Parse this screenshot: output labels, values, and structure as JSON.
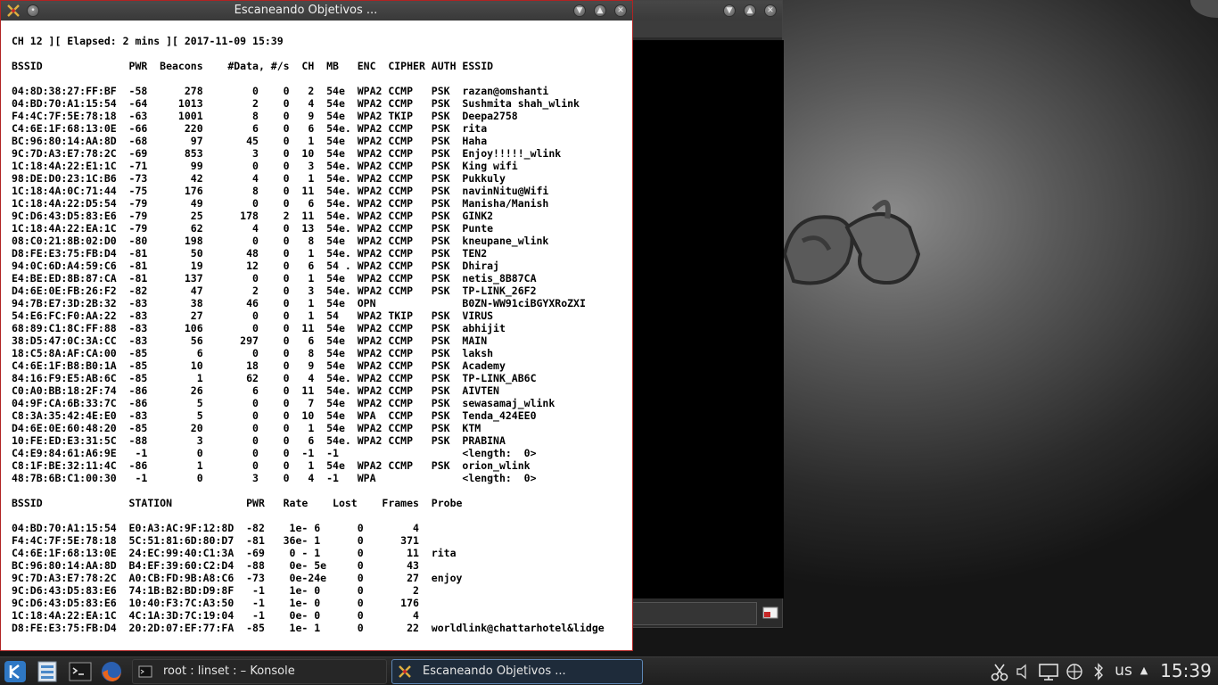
{
  "main_window": {
    "title": "Escaneando Objetivos ...",
    "terminal_lines": [
      "CH 12 ][ Elapsed: 2 mins ][ 2017-11-09 15:39",
      "",
      "BSSID              PWR  Beacons    #Data, #/s  CH  MB   ENC  CIPHER AUTH ESSID",
      "",
      "04:8D:38:27:FF:BF  -58      278        0    0   2  54e  WPA2 CCMP   PSK  razan@omshanti",
      "04:BD:70:A1:15:54  -64     1013        2    0   4  54e  WPA2 CCMP   PSK  Sushmita shah_wlink",
      "F4:4C:7F:5E:78:18  -63     1001        8    0   9  54e  WPA2 TKIP   PSK  Deepa2758",
      "C4:6E:1F:68:13:0E  -66      220        6    0   6  54e. WPA2 CCMP   PSK  rita",
      "BC:96:80:14:AA:8D  -68       97       45    0   1  54e  WPA2 CCMP   PSK  Haha",
      "9C:7D:A3:E7:78:2C  -69      853        3    0  10  54e  WPA2 CCMP   PSK  Enjoy!!!!!_wlink",
      "1C:18:4A:22:E1:1C  -71       99        0    0   3  54e. WPA2 CCMP   PSK  King wifi",
      "98:DE:D0:23:1C:B6  -73       42        4    0   1  54e. WPA2 CCMP   PSK  Pukkuly",
      "1C:18:4A:0C:71:44  -75      176        8    0  11  54e. WPA2 CCMP   PSK  navinNitu@Wifi",
      "1C:18:4A:22:D5:54  -79       49        0    0   6  54e. WPA2 CCMP   PSK  Manisha/Manish",
      "9C:D6:43:D5:83:E6  -79       25      178    2  11  54e. WPA2 CCMP   PSK  GINK2",
      "1C:18:4A:22:EA:1C  -79       62        4    0  13  54e. WPA2 CCMP   PSK  Punte",
      "08:C0:21:8B:02:D0  -80      198        0    0   8  54e  WPA2 CCMP   PSK  kneupane_wlink",
      "D8:FE:E3:75:FB:D4  -81       50       48    0   1  54e. WPA2 CCMP   PSK  TEN2",
      "94:0C:6D:A4:59:C6  -81       19       12    0   6  54 . WPA2 CCMP   PSK  Dhiraj",
      "E4:BE:ED:8B:87:CA  -81      137        0    0   1  54e  WPA2 CCMP   PSK  netis_8B87CA",
      "D4:6E:0E:FB:26:F2  -82       47        2    0   3  54e. WPA2 CCMP   PSK  TP-LINK_26F2",
      "94:7B:E7:3D:2B:32  -83       38       46    0   1  54e  OPN              B0ZN-WW91ciBGYXRoZXI",
      "54:E6:FC:F0:AA:22  -83       27        0    0   1  54   WPA2 TKIP   PSK  VIRUS",
      "68:89:C1:8C:FF:88  -83      106        0    0  11  54e  WPA2 CCMP   PSK  abhijit",
      "38:D5:47:0C:3A:CC  -83       56      297    0   6  54e  WPA2 CCMP   PSK  MAIN",
      "18:C5:8A:AF:CA:00  -85        6        0    0   8  54e  WPA2 CCMP   PSK  laksh",
      "C4:6E:1F:B8:B0:1A  -85       10       18    0   9  54e  WPA2 CCMP   PSK  Academy",
      "84:16:F9:E5:AB:6C  -85        1       62    0   4  54e. WPA2 CCMP   PSK  TP-LINK_AB6C",
      "C0:A0:BB:18:2F:74  -86       26        6    0  11  54e. WPA2 CCMP   PSK  AIVTEN",
      "04:9F:CA:6B:33:7C  -86        5        0    0   7  54e  WPA2 CCMP   PSK  sewasamaj_wlink",
      "C8:3A:35:42:4E:E0  -83        5        0    0  10  54e  WPA  CCMP   PSK  Tenda_424EE0",
      "D4:6E:0E:60:48:20  -85       20        0    0   1  54e  WPA2 CCMP   PSK  KTM",
      "10:FE:ED:E3:31:5C  -88        3        0    0   6  54e. WPA2 CCMP   PSK  PRABINA",
      "C4:E9:84:61:A6:9E   -1        0        0    0  -1  -1                    <length:  0>",
      "C8:1F:BE:32:11:4C  -86        1        0    0   1  54e  WPA2 CCMP   PSK  orion_wlink",
      "48:7B:6B:C1:00:30   -1        0        3    0   4  -1   WPA              <length:  0>",
      "",
      "BSSID              STATION            PWR   Rate    Lost    Frames  Probe",
      "",
      "04:BD:70:A1:15:54  E0:A3:AC:9F:12:8D  -82    1e- 6      0        4",
      "F4:4C:7F:5E:78:18  5C:51:81:6D:80:D7  -81   36e- 1      0      371",
      "C4:6E:1F:68:13:0E  24:EC:99:40:C1:3A  -69    0 - 1      0       11  rita",
      "BC:96:80:14:AA:8D  B4:EF:39:60:C2:D4  -88    0e- 5e     0       43",
      "9C:7D:A3:E7:78:2C  A0:CB:FD:9B:A8:C6  -73    0e-24e     0       27  enjoy",
      "9C:D6:43:D5:83:E6  74:1B:B2:BD:D9:8F   -1    1e- 0      0        2",
      "9C:D6:43:D5:83:E6  10:40:F3:7C:A3:50   -1    1e- 0      0      176",
      "1C:18:4A:22:EA:1C  4C:1A:3D:7C:19:04   -1    0e- 0      0        4",
      "D8:FE:E3:75:FB:D4  20:2D:07:EF:77:FA  -85    1e- 1      0       22  worldlink@chattarhotel&lidge"
    ]
  },
  "taskbar": {
    "tasks": [
      {
        "label": "root : linset : – Konsole"
      },
      {
        "label": "Escaneando Objetivos ..."
      }
    ],
    "keyboard_layout": "us",
    "clock": "15:39"
  },
  "colors": {
    "active_border": "#b02323",
    "active_task_border": "#5e87b5"
  }
}
